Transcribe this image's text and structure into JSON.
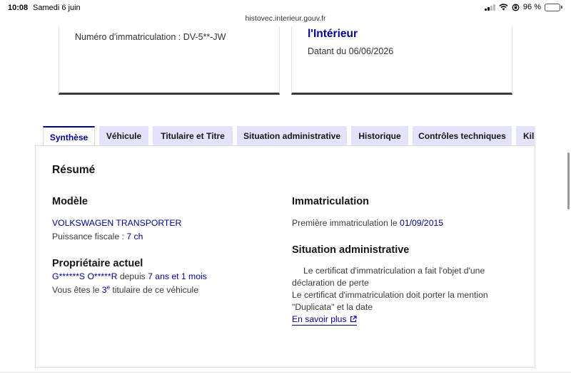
{
  "status_bar": {
    "time": "10:08",
    "date": "Samedi 6 juin",
    "battery": "96 %",
    "battery_level": 0.96
  },
  "browser": {
    "url": "histovec.interieur.gouv.fr"
  },
  "cards": {
    "left": {
      "plate_text": "Numéro d'immatriculation : DV-5**-JW"
    },
    "right": {
      "heading": "l'Intérieur",
      "dated": "Datant du 06/06/2026"
    }
  },
  "tabs": [
    {
      "label": "Synthèse",
      "active": true
    },
    {
      "label": "Véhicule",
      "active": false
    },
    {
      "label": "Titulaire et Titre",
      "active": false
    },
    {
      "label": "Situation administrative",
      "active": false
    },
    {
      "label": "Historique",
      "active": false
    },
    {
      "label": "Contrôles techniques",
      "active": false
    },
    {
      "label": "Kil",
      "active": false
    }
  ],
  "summary": {
    "title": "Résumé",
    "model": {
      "heading": "Modèle",
      "name": "VOLKSWAGEN TRANSPORTER",
      "power_label": "Puissance fiscale : ",
      "power_value": "7 ch"
    },
    "owner": {
      "heading": "Propriétaire actuel",
      "name": "G******S O*****R",
      "since_label": " depuis ",
      "since_value": "7 ans et 1 mois",
      "rank_prefix": "Vous êtes le ",
      "rank_number": "3",
      "rank_suffix": "e",
      "rank_end": " titulaire de ce véhicule"
    },
    "registration": {
      "heading": "Immatriculation",
      "first_label": "Première immatriculation le ",
      "first_date": "01/09/2015"
    },
    "admin": {
      "heading": "Situation administrative",
      "line1": "Le certificat d'immatriculation a fait l'objet d'une",
      "line2": "déclaration de perte",
      "line3": "Le certificat d'immatriculation doit porter la mention",
      "line4": "\"Duplicata\" et la date",
      "more_link": "En savoir plus"
    }
  },
  "colors": {
    "accent": "#000091",
    "tab_background": "#e3e3fd"
  }
}
